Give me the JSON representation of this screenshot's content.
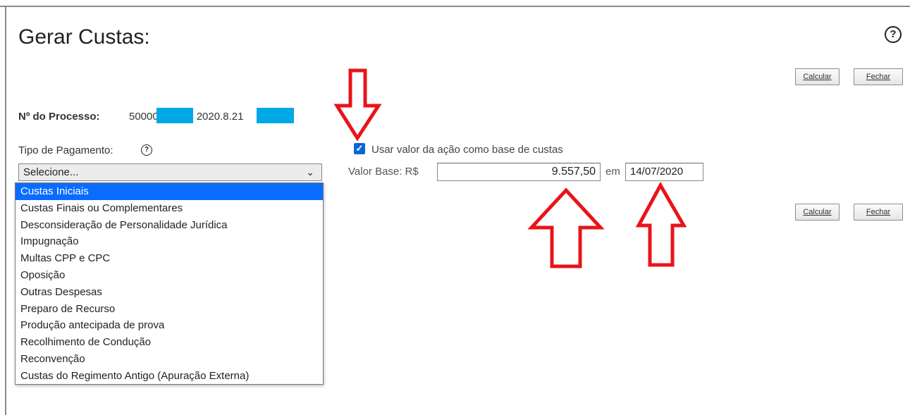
{
  "page": {
    "title": "Gerar Custas:",
    "help_glyph": "?"
  },
  "toolbar_top": {
    "calcular": "Calcular",
    "fechar": "Fechar"
  },
  "toolbar_bottom": {
    "calcular": "Calcular",
    "fechar": "Fechar"
  },
  "processo": {
    "label": "Nº do Processo:",
    "part1": "50000",
    "part2": "2020.8.21"
  },
  "tipo_pagamento": {
    "label": "Tipo de Pagamento:",
    "help_glyph": "?",
    "selected": "Selecione...",
    "options": [
      "Custas Iniciais",
      "Custas Finais ou Complementares",
      "Desconsideração de Personalidade Jurídica",
      "Impugnação",
      "Multas CPP e CPC",
      "Oposição",
      "Outras Despesas",
      "Preparo de Recurso",
      "Produção antecipada de prova",
      "Recolhimento de Condução",
      "Reconvenção",
      "Custas do Regimento Antigo (Apuração Externa)"
    ],
    "highlighted_option": "Custas Iniciais"
  },
  "usar_valor": {
    "checked": true,
    "label": "Usar valor da ação como base de custas"
  },
  "valor_base": {
    "label": "Valor Base: R$",
    "value": "9.557,50",
    "em_label": "em",
    "date": "14/07/2020"
  },
  "colors": {
    "accent": "#0a6cff",
    "checkbox": "#0a66d8",
    "redaction": "#00a8e8",
    "annotation_arrow": "#e8141a"
  }
}
